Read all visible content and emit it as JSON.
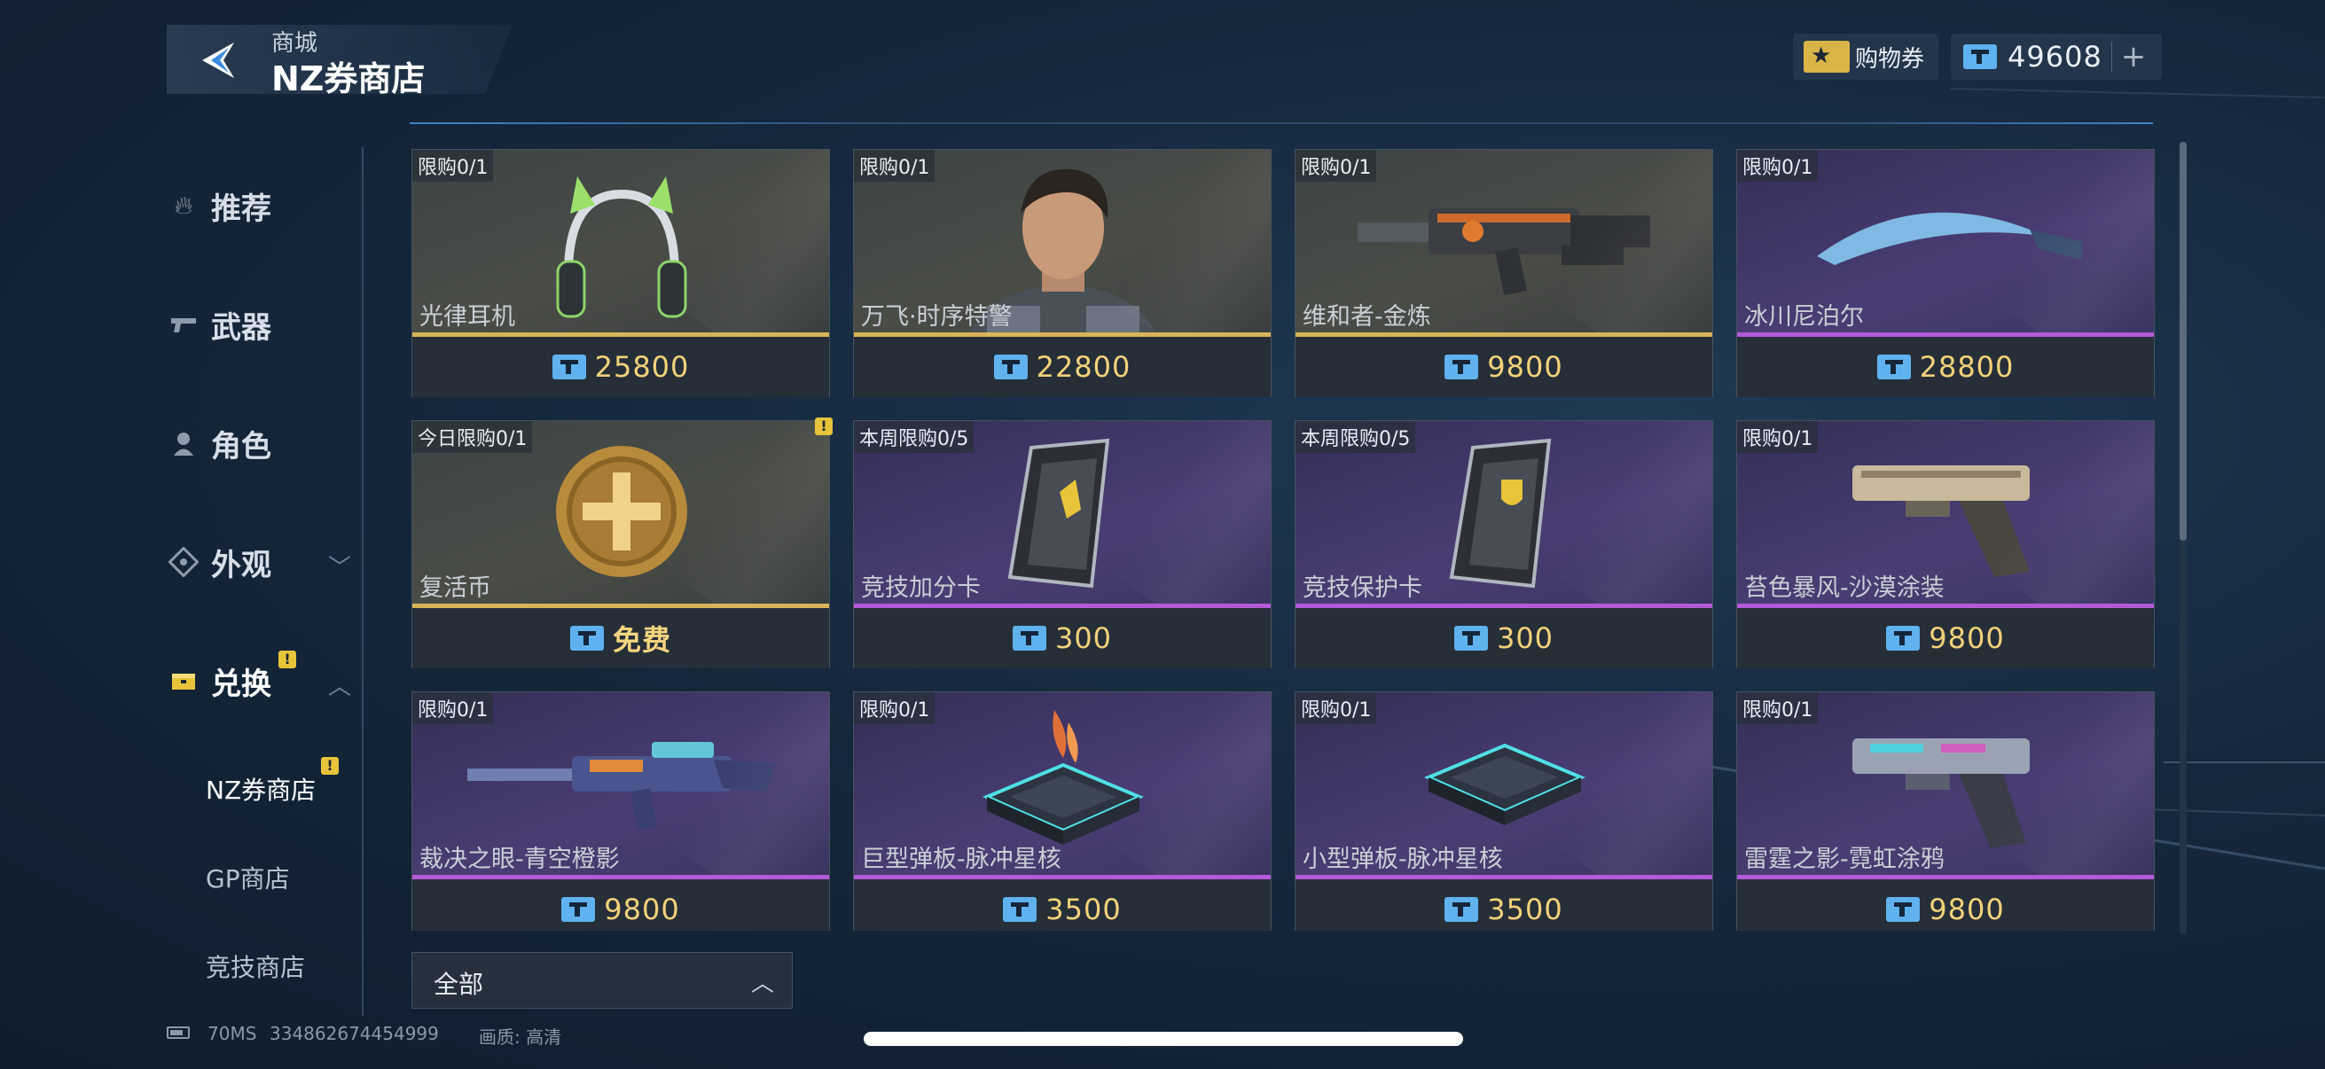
{
  "header": {
    "breadcrumb": "商城",
    "title": "NZ券商店"
  },
  "currency": {
    "voucher_label": "购物券",
    "nz_amount": "49608",
    "plus": "+"
  },
  "sidebar": {
    "items": [
      {
        "label": "推荐",
        "icon": "fire-icon"
      },
      {
        "label": "武器",
        "icon": "gun-icon"
      },
      {
        "label": "角色",
        "icon": "person-icon"
      },
      {
        "label": "外观",
        "icon": "diamond-icon"
      },
      {
        "label": "兑换",
        "icon": "box-icon"
      }
    ],
    "sub_items": [
      {
        "label": "NZ券商店"
      },
      {
        "label": "GP商店"
      },
      {
        "label": "竞技商店"
      }
    ]
  },
  "products": [
    {
      "limit": "限购0/1",
      "name": "光律耳机",
      "price": "25800",
      "rarity": "gold"
    },
    {
      "limit": "限购0/1",
      "name": "万飞·时序特警",
      "price": "22800",
      "rarity": "gold"
    },
    {
      "limit": "限购0/1",
      "name": "维和者-金炼",
      "price": "9800",
      "rarity": "gold"
    },
    {
      "limit": "限购0/1",
      "name": "冰川尼泊尔",
      "price": "28800",
      "rarity": "purple"
    },
    {
      "limit": "今日限购0/1",
      "name": "复活币",
      "price": "免费",
      "rarity": "gold"
    },
    {
      "limit": "本周限购0/5",
      "name": "竞技加分卡",
      "price": "300",
      "rarity": "purple"
    },
    {
      "limit": "本周限购0/5",
      "name": "竞技保护卡",
      "price": "300",
      "rarity": "purple"
    },
    {
      "limit": "限购0/1",
      "name": "苔色暴风-沙漠涂装",
      "price": "9800",
      "rarity": "purple"
    },
    {
      "limit": "限购0/1",
      "name": "裁决之眼-青空橙影",
      "price": "9800",
      "rarity": "purple"
    },
    {
      "limit": "限购0/1",
      "name": "巨型弹板-脉冲星核",
      "price": "3500",
      "rarity": "purple"
    },
    {
      "limit": "限购0/1",
      "name": "小型弹板-脉冲星核",
      "price": "3500",
      "rarity": "purple"
    },
    {
      "limit": "限购0/1",
      "name": "雷霆之影-霓虹涂鸦",
      "price": "9800",
      "rarity": "purple"
    }
  ],
  "filter": {
    "label": "全部"
  },
  "footer": {
    "ping": "70MS",
    "id": "334862674454999",
    "quality": "画质: 高清"
  },
  "colors": {
    "gold": "#d8b458",
    "purple": "#b25ad8",
    "price": "#f2d27a",
    "ticket": "#5fb2ee"
  }
}
